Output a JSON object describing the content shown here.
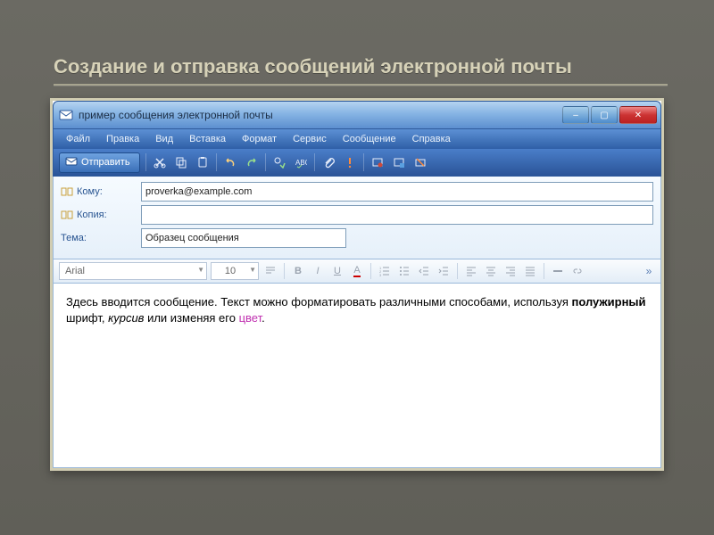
{
  "slide": {
    "title": "Создание и отправка сообщений электронной почты"
  },
  "window": {
    "title": "пример сообщения электронной почты",
    "buttons": {
      "min": "–",
      "max": "▢",
      "close": "✕"
    }
  },
  "menubar": {
    "items": [
      "Файл",
      "Правка",
      "Вид",
      "Вставка",
      "Формат",
      "Сервис",
      "Сообщение",
      "Справка"
    ]
  },
  "toolbar": {
    "send_label": "Отправить"
  },
  "headers": {
    "to_label": "Кому:",
    "to_value": "proverka@example.com",
    "cc_label": "Копия:",
    "cc_value": "",
    "subject_label": "Тема:",
    "subject_value": "Образец сообщения"
  },
  "format": {
    "font": "Arial",
    "size": "10",
    "bold": "B",
    "italic": "I",
    "underline": "U",
    "fontcolor": "A"
  },
  "body": {
    "text_before_bold": "Здесь вводится сообщение. Текст можно форматировать различными способами, используя ",
    "bold_word": "полужирный",
    "text_after_bold": " шрифт, ",
    "italic_word": "курсив",
    "text_after_italic": " или изменяя его ",
    "color_word": "цвет",
    "text_end": "."
  }
}
